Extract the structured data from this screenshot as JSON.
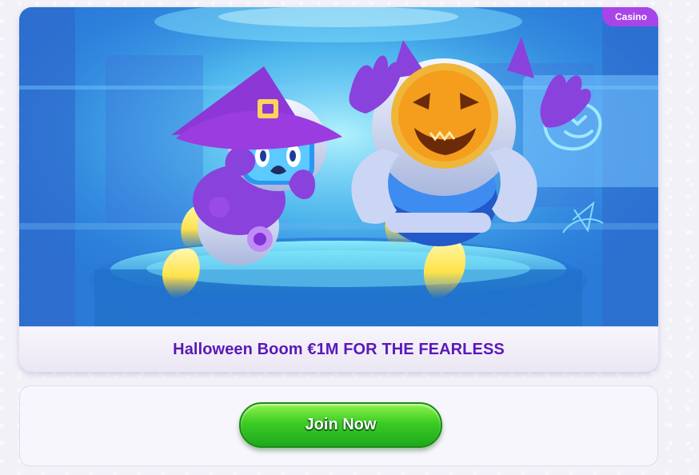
{
  "promo": {
    "badge": "Casino",
    "title": "Halloween Boom €1M FOR THE FEARLESS",
    "banner_scene": {
      "left_character": "witch-robot",
      "right_character": "pumpkin-robot",
      "colors": {
        "sky": "#3fb4e8",
        "purple": "#7f33d5",
        "pumpkin": "#f3a61d",
        "flame": "#ffe34a"
      }
    }
  },
  "cta": {
    "join_label": "Join Now"
  },
  "colors": {
    "badge": "#a845e8",
    "title": "#5b18b8",
    "button": "#3ccc25",
    "background": "#f3f1f8"
  }
}
